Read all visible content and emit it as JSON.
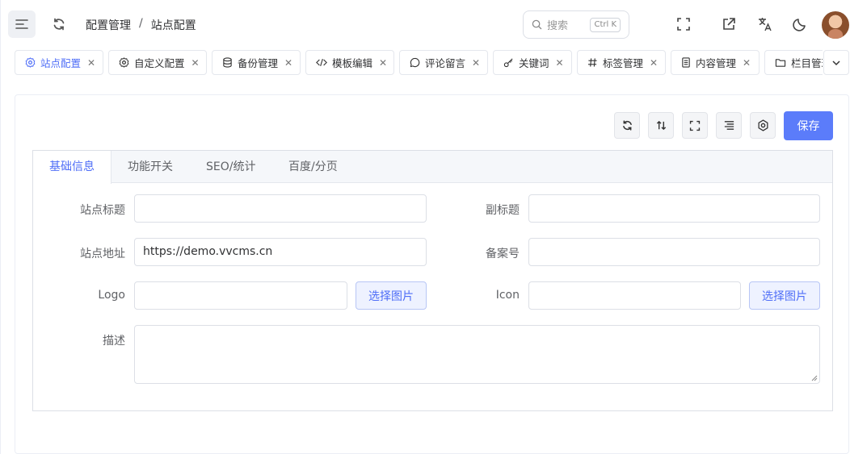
{
  "breadcrumb": {
    "parent": "配置管理",
    "separator": "/",
    "current": "站点配置"
  },
  "search": {
    "placeholder": "搜索",
    "shortcut": "Ctrl K"
  },
  "tabs": [
    {
      "label": "站点配置",
      "icon": "gear-icon",
      "active": true
    },
    {
      "label": "自定义配置",
      "icon": "gear-icon"
    },
    {
      "label": "备份管理",
      "icon": "database-icon"
    },
    {
      "label": "模板编辑",
      "icon": "code-icon"
    },
    {
      "label": "评论留言",
      "icon": "comment-icon"
    },
    {
      "label": "关键词",
      "icon": "key-icon"
    },
    {
      "label": "标签管理",
      "icon": "hash-icon"
    },
    {
      "label": "内容管理",
      "icon": "document-icon"
    },
    {
      "label": "栏目管理",
      "icon": "folder-icon"
    }
  ],
  "toolbar": {
    "save_label": "保存"
  },
  "form_tabs": [
    {
      "label": "基础信息",
      "active": true
    },
    {
      "label": "功能开关"
    },
    {
      "label": "SEO/统计"
    },
    {
      "label": "百度/分页"
    }
  ],
  "form": {
    "site_title": {
      "label": "站点标题",
      "value": ""
    },
    "subtitle": {
      "label": "副标题",
      "value": ""
    },
    "site_url": {
      "label": "站点地址",
      "value": "https://demo.vvcms.cn"
    },
    "icp": {
      "label": "备案号",
      "value": ""
    },
    "logo": {
      "label": "Logo",
      "value": "",
      "button": "选择图片"
    },
    "icon": {
      "label": "Icon",
      "value": "",
      "button": "选择图片"
    },
    "description": {
      "label": "描述",
      "value": ""
    }
  },
  "colors": {
    "accent": "#5b7cfa",
    "active_tab_text": "#4f6ef7"
  }
}
